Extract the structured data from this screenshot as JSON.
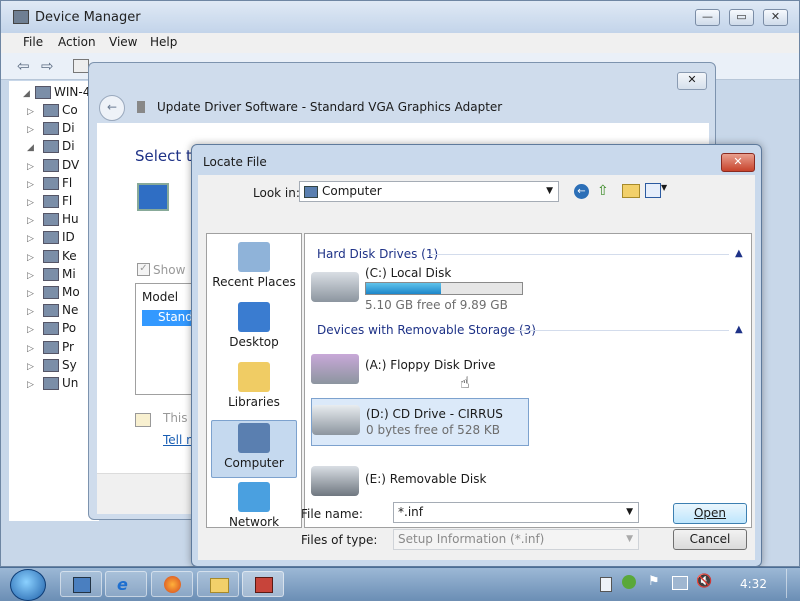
{
  "device_manager": {
    "title": "Device Manager",
    "menu": [
      "File",
      "Action",
      "View",
      "Help"
    ],
    "tree_root": "WIN-4",
    "tree_items": [
      "Co",
      "Di",
      "Di",
      "DV",
      "Fl",
      "Fl",
      "Hu",
      "ID",
      "Ke",
      "Mi",
      "Mo",
      "Ne",
      "Po",
      "Pr",
      "Sy",
      "Un"
    ]
  },
  "update_driver": {
    "title": "Update Driver Software - Standard VGA Graphics Adapter",
    "heading": "Select th",
    "show_label": "Show",
    "model_header": "Model",
    "model_item": "Stand",
    "info_text": "This",
    "link_text": "Tell m"
  },
  "locate_file": {
    "title": "Locate File",
    "look_in_label": "Look in:",
    "look_in_value": "Computer",
    "places": [
      {
        "label": "Recent Places",
        "icon": "recent-places-icon"
      },
      {
        "label": "Desktop",
        "icon": "desktop-icon"
      },
      {
        "label": "Libraries",
        "icon": "libraries-icon"
      },
      {
        "label": "Computer",
        "icon": "computer-icon"
      },
      {
        "label": "Network",
        "icon": "network-icon"
      }
    ],
    "groups": {
      "hdd": "Hard Disk Drives (1)",
      "removable": "Devices with Removable Storage (3)"
    },
    "drives": [
      {
        "name": "(C:) Local Disk",
        "detail": "5.10 GB free of 9.89 GB",
        "used_fraction": 0.48
      },
      {
        "name": "(A:) Floppy Disk Drive"
      },
      {
        "name": "(D:) CD Drive - CIRRUS",
        "detail": "0 bytes free of 528 KB"
      },
      {
        "name": "(E:) Removable Disk"
      }
    ],
    "file_name_label": "File name:",
    "file_name_value": "*.inf",
    "file_type_label": "Files of type:",
    "file_type_value": "Setup Information (*.inf)",
    "open_button": "Open",
    "cancel_button": "Cancel"
  },
  "taskbar": {
    "clock": "4:32"
  }
}
